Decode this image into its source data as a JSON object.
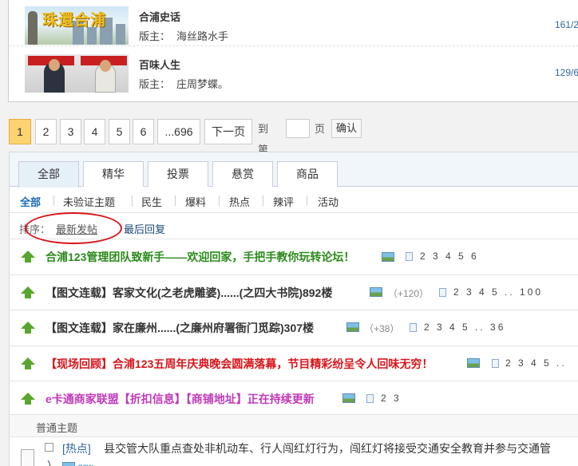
{
  "forums": [
    {
      "name": "合浦史话",
      "mod_label": "版主：",
      "mod": "海丝路水手",
      "stat": "161/2",
      "thumb_text": "珠還合浦"
    },
    {
      "name": "百味人生",
      "mod_label": "版主：",
      "mod": "庄周梦蝶。",
      "stat": "129/6"
    }
  ],
  "pager": {
    "pages": [
      "1",
      "2",
      "3",
      "4",
      "5",
      "6",
      "...696"
    ],
    "next": "下一页",
    "goto_label": "到第",
    "goto_suffix": "页",
    "confirm": "确认",
    "current": "1"
  },
  "tabs": [
    "全部",
    "精华",
    "投票",
    "悬赏",
    "商品"
  ],
  "subnav": [
    "全部",
    "未验证主题",
    "民生",
    "爆料",
    "热点",
    "辣评",
    "活动"
  ],
  "sort": {
    "label": "排序：",
    "options": [
      "最新发帖",
      "最后回复"
    ]
  },
  "threads": [
    {
      "title": "合浦123管理团队致新手——欢迎回家，手把手教你玩转论坛！",
      "color": "#2a8a1a",
      "plus": "",
      "pages": "2 3 4 5 6"
    },
    {
      "title": "【图文连载】客家文化(之老虎雕婆)......(之四大书院)892楼",
      "color": "#333333",
      "plus": "（+120）",
      "pages": "2 3 4 5 .. 100"
    },
    {
      "title": "【图文连载】家在廉州......(之廉州府署衙门觅踪)307楼",
      "color": "#333333",
      "plus": "（+38）",
      "pages": "2 3 4 5 .. 36"
    },
    {
      "title": "【现场回顾】合浦123五周年庆典晚会圆满落幕，节目精彩纷呈令人回味无穷！",
      "color": "#d9141a",
      "plus": "",
      "pages": "2 3 4 5 .."
    },
    {
      "title": "e卡通商家联盟【折扣信息】【商铺地址】正在持续更新",
      "color": "#c03ab8",
      "plus": "",
      "pages": "2 3"
    }
  ],
  "normal_header": "普通主题",
  "last": {
    "tag": "[热点]",
    "text": "县交管大队重点查处非机动车、行人闯红灯行为，闯红灯将接受交通安全教育并参与交通管",
    "tail": "）",
    "new_label": "new"
  }
}
